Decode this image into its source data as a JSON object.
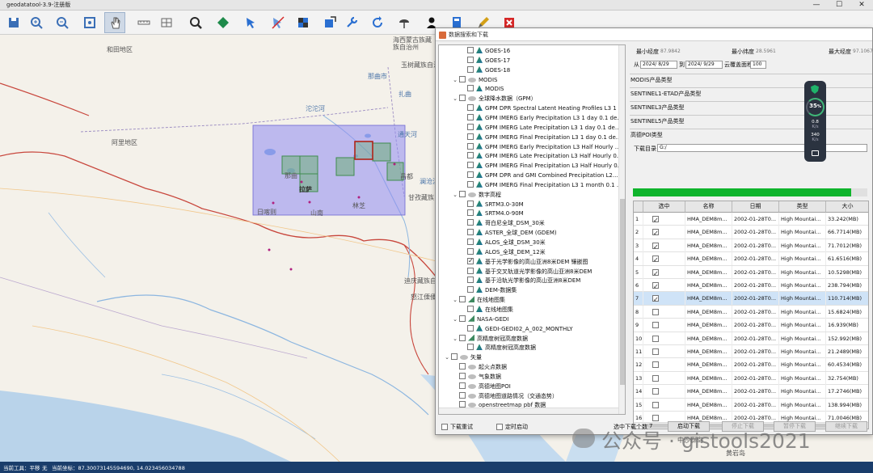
{
  "app": {
    "title": "geodatatool-3.9-注册版"
  },
  "window_controls": [
    "—",
    "☐",
    "✕"
  ],
  "toolbar": {
    "buttons": [
      {
        "name": "save-icon",
        "color": "#3b6fb6"
      },
      {
        "name": "zoom-in-icon",
        "color": "#3b6fb6"
      },
      {
        "name": "zoom-out-icon",
        "color": "#3b6fb6"
      },
      {
        "name": "full-extent-icon",
        "color": "#3b6fb6"
      },
      {
        "name": "pan-icon",
        "color": "#555555",
        "active": true
      },
      {
        "name": "measure-icon",
        "color": "#666666"
      },
      {
        "name": "grid-icon",
        "color": "#666666"
      },
      {
        "name": "identify-icon",
        "color": "#2a2a2a"
      },
      {
        "name": "layer-icon",
        "color": "#1e8a4a"
      },
      {
        "name": "select-icon",
        "color": "#2a6fd1"
      },
      {
        "name": "clear-select-icon",
        "color": "#2a6fd1"
      },
      {
        "name": "checker-icon",
        "color": "#333333"
      },
      {
        "name": "export-icon",
        "color": "#2a6fd1"
      },
      {
        "name": "tools-icon",
        "color": "#2a6fd1"
      },
      {
        "name": "refresh-icon",
        "color": "#2a6fd1"
      },
      {
        "name": "cloud-icon",
        "color": "#444444"
      },
      {
        "name": "user-icon",
        "color": "#111111"
      },
      {
        "name": "book-icon",
        "color": "#2a6fd1"
      },
      {
        "name": "pencil-icon",
        "color": "#d4a017"
      },
      {
        "name": "close-red-icon",
        "color": "#d62828"
      }
    ]
  },
  "map": {
    "labels": [
      {
        "text": "和田地区",
        "style": ""
      },
      {
        "text": "海西蒙古族藏族自治州",
        "style": ""
      },
      {
        "text": "玉树藏族自治州",
        "style": ""
      },
      {
        "text": "那曲市",
        "style": "blue"
      },
      {
        "text": "扎曲",
        "style": "blue"
      },
      {
        "text": "沱沱河",
        "style": "blue"
      },
      {
        "text": "阿里地区",
        "style": ""
      },
      {
        "text": "那曲",
        "style": ""
      },
      {
        "text": "拉萨",
        "style": "bold"
      },
      {
        "text": "日喀则",
        "style": ""
      },
      {
        "text": "山南",
        "style": ""
      },
      {
        "text": "林芝",
        "style": ""
      },
      {
        "text": "昌都",
        "style": ""
      },
      {
        "text": "澜沧江",
        "style": "blue"
      },
      {
        "text": "迪庆藏族自治州",
        "style": ""
      },
      {
        "text": "怒江傈僳族自治州",
        "style": ""
      },
      {
        "text": "通天河",
        "style": "blue"
      },
      {
        "text": "甘孜藏族自治州",
        "style": ""
      },
      {
        "text": "中沙群岛",
        "style": ""
      },
      {
        "text": "黄岩岛",
        "style": ""
      }
    ]
  },
  "dialog": {
    "title": "数据搜索和下载",
    "tree": [
      {
        "level": 2,
        "exp": "",
        "checked": false,
        "icon": "leaf",
        "label": "GOES-16"
      },
      {
        "level": 2,
        "exp": "",
        "checked": false,
        "icon": "leaf",
        "label": "GOES-17"
      },
      {
        "level": 2,
        "exp": "",
        "checked": false,
        "icon": "leaf",
        "label": "GOES-18"
      },
      {
        "level": 1,
        "exp": "⌄",
        "checked": false,
        "icon": "folder",
        "label": "MODIS"
      },
      {
        "level": 2,
        "exp": "",
        "checked": false,
        "icon": "leaf",
        "label": "MODIS"
      },
      {
        "level": 1,
        "exp": "⌄",
        "checked": false,
        "icon": "folder",
        "label": "全球降水数据（GPM）"
      },
      {
        "level": 2,
        "exp": "",
        "checked": false,
        "icon": "leaf",
        "label": "GPM DPR Spectral Latent Heating Profiles L3 1 ..."
      },
      {
        "level": 2,
        "exp": "",
        "checked": false,
        "icon": "leaf",
        "label": "GPM IMERG Early Precipitation L3 1 day 0.1 de..."
      },
      {
        "level": 2,
        "exp": "",
        "checked": false,
        "icon": "leaf",
        "label": "GPM IMERG Late Precipitation L3 1 day 0.1 de..."
      },
      {
        "level": 2,
        "exp": "",
        "checked": false,
        "icon": "leaf",
        "label": "GPM IMERG Final Precipitation L3 1 day 0.1 de..."
      },
      {
        "level": 2,
        "exp": "",
        "checked": false,
        "icon": "leaf",
        "label": "GPM IMERG Early Precipitation L3 Half Hourly ..."
      },
      {
        "level": 2,
        "exp": "",
        "checked": false,
        "icon": "leaf",
        "label": "GPM IMERG Late Precipitation L3 Half Hourly 0..."
      },
      {
        "level": 2,
        "exp": "",
        "checked": false,
        "icon": "leaf",
        "label": "GPM IMERG Final Precipitation L3 Half Hourly 0..."
      },
      {
        "level": 2,
        "exp": "",
        "checked": false,
        "icon": "leaf",
        "label": "GPM DPR and GMI Combined Precipitation L2..."
      },
      {
        "level": 2,
        "exp": "",
        "checked": false,
        "icon": "leaf",
        "label": "GPM IMERG Final Precipitation L3 1 month 0.1 ..."
      },
      {
        "level": 1,
        "exp": "⌄",
        "checked": false,
        "icon": "folder",
        "label": "数字高程"
      },
      {
        "level": 2,
        "exp": "",
        "checked": false,
        "icon": "leaf",
        "label": "SRTM3.0-30M"
      },
      {
        "level": 2,
        "exp": "",
        "checked": false,
        "icon": "leaf",
        "label": "SRTM4.0-90M"
      },
      {
        "level": 2,
        "exp": "",
        "checked": false,
        "icon": "leaf",
        "label": "哥白尼全球_DSM_30米"
      },
      {
        "level": 2,
        "exp": "",
        "checked": false,
        "icon": "leaf",
        "label": "ASTER_全球_DEM (GDEM)"
      },
      {
        "level": 2,
        "exp": "",
        "checked": false,
        "icon": "leaf",
        "label": "ALOS_全球_DSM_30米"
      },
      {
        "level": 2,
        "exp": "",
        "checked": false,
        "icon": "leaf",
        "label": "ALOS_全球_DEM_12米"
      },
      {
        "level": 2,
        "exp": "",
        "checked": true,
        "icon": "leaf",
        "label": "基于光学影像的高山亚洲8米DEM 镶嵌图"
      },
      {
        "level": 2,
        "exp": "",
        "checked": false,
        "icon": "leaf",
        "label": "基于交叉轨道光学影像的高山亚洲8米DEM"
      },
      {
        "level": 2,
        "exp": "",
        "checked": false,
        "icon": "leaf",
        "label": "基于沿轨光学影像的高山亚洲8米DEM"
      },
      {
        "level": 2,
        "exp": "",
        "checked": false,
        "icon": "leaf",
        "label": "DEM-数据集"
      },
      {
        "level": 1,
        "exp": "⌄",
        "checked": false,
        "icon": "ruler",
        "label": "在线地图集"
      },
      {
        "level": 2,
        "exp": "",
        "checked": false,
        "icon": "leaf",
        "label": "在线地图集"
      },
      {
        "level": 1,
        "exp": "⌄",
        "checked": false,
        "icon": "ruler",
        "label": "NASA-GEDI"
      },
      {
        "level": 2,
        "exp": "",
        "checked": false,
        "icon": "leaf",
        "label": "GEDI-GEDI02_A_002_MONTHLY"
      },
      {
        "level": 1,
        "exp": "⌄",
        "checked": false,
        "icon": "ruler",
        "label": "高精度树冠高度数据"
      },
      {
        "level": 2,
        "exp": "",
        "checked": false,
        "icon": "leaf",
        "label": "高精度树冠高度数据"
      },
      {
        "level": 0,
        "exp": "⌄",
        "checked": false,
        "icon": "folder",
        "label": "矢量"
      },
      {
        "level": 1,
        "exp": "",
        "checked": false,
        "icon": "folder",
        "label": "起火点数据"
      },
      {
        "level": 1,
        "exp": "",
        "checked": false,
        "icon": "folder",
        "label": "气象数据"
      },
      {
        "level": 1,
        "exp": "",
        "checked": false,
        "icon": "folder",
        "label": "高德地图POI"
      },
      {
        "level": 1,
        "exp": "",
        "checked": false,
        "icon": "folder",
        "label": "高德地图道路情况（交通态势）"
      },
      {
        "level": 1,
        "exp": "",
        "checked": false,
        "icon": "folder",
        "label": "openstreetmap pbf 数据"
      }
    ],
    "bounds": {
      "min_lon_label": "最小经度",
      "min_lon_value": "87.9842",
      "min_lat_label": "最小纬度",
      "min_lat_value": "28.5961",
      "max_lon_label": "最大经度",
      "max_lon_value": "97.1067"
    },
    "date_filter": {
      "from_label": "从",
      "from_value": "2024/ 8/29",
      "to_label": "到",
      "to_value": "2024/ 9/29",
      "cloud_label": "云覆盖面积",
      "cloud_value": "100"
    },
    "sections": [
      "MODIS产品类型",
      "SENTINEL1-ETAD产品类型",
      "SENTINEL3产品类型",
      "SENTINEL5产品类型",
      "高德POI类型"
    ],
    "download_dir_label": "下载目录",
    "download_dir_value": "G:/",
    "progress_fraction": 0.93,
    "table": {
      "headers": [
        "",
        "选中",
        "名称",
        "日期",
        "类型",
        "大小"
      ],
      "rows": [
        {
          "idx": "1",
          "checked": true,
          "name": "HMA_DEM8m...",
          "date": "2002-01-28T0...",
          "type": "High Mountai...",
          "size": "33.242(MB)"
        },
        {
          "idx": "2",
          "checked": true,
          "name": "HMA_DEM8m...",
          "date": "2002-01-28T0...",
          "type": "High Mountai...",
          "size": "66.7714(MB)"
        },
        {
          "idx": "3",
          "checked": true,
          "name": "HMA_DEM8m...",
          "date": "2002-01-28T0...",
          "type": "High Mountai...",
          "size": "71.7012(MB)"
        },
        {
          "idx": "4",
          "checked": true,
          "name": "HMA_DEM8m...",
          "date": "2002-01-28T0...",
          "type": "High Mountai...",
          "size": "61.6516(MB)"
        },
        {
          "idx": "5",
          "checked": true,
          "name": "HMA_DEM8m...",
          "date": "2002-01-28T0...",
          "type": "High Mountai...",
          "size": "10.5298(MB)"
        },
        {
          "idx": "6",
          "checked": true,
          "name": "HMA_DEM8m...",
          "date": "2002-01-28T0...",
          "type": "High Mountai...",
          "size": "238.794(MB)"
        },
        {
          "idx": "7",
          "checked": true,
          "name": "HMA_DEM8m...",
          "date": "2002-01-28T0...",
          "type": "High Mountai...",
          "size": "110.714(MB)",
          "selected": true
        },
        {
          "idx": "8",
          "checked": false,
          "name": "HMA_DEM8m...",
          "date": "2002-01-28T0...",
          "type": "High Mountai...",
          "size": "15.6824(MB)"
        },
        {
          "idx": "9",
          "checked": false,
          "name": "HMA_DEM8m...",
          "date": "2002-01-28T0...",
          "type": "High Mountai...",
          "size": "16.939(MB)"
        },
        {
          "idx": "10",
          "checked": false,
          "name": "HMA_DEM8m...",
          "date": "2002-01-28T0...",
          "type": "High Mountai...",
          "size": "152.992(MB)"
        },
        {
          "idx": "11",
          "checked": false,
          "name": "HMA_DEM8m...",
          "date": "2002-01-28T0...",
          "type": "High Mountai...",
          "size": "21.2489(MB)"
        },
        {
          "idx": "12",
          "checked": false,
          "name": "HMA_DEM8m...",
          "date": "2002-01-28T0...",
          "type": "High Mountai...",
          "size": "60.4534(MB)"
        },
        {
          "idx": "13",
          "checked": false,
          "name": "HMA_DEM8m...",
          "date": "2002-01-28T0...",
          "type": "High Mountai...",
          "size": "32.754(MB)"
        },
        {
          "idx": "14",
          "checked": false,
          "name": "HMA_DEM8m...",
          "date": "2002-01-28T0...",
          "type": "High Mountai...",
          "size": "17.2746(MB)"
        },
        {
          "idx": "15",
          "checked": false,
          "name": "HMA_DEM8m...",
          "date": "2002-01-28T0...",
          "type": "High Mountai...",
          "size": "138.994(MB)"
        },
        {
          "idx": "16",
          "checked": false,
          "name": "HMA_DEM8m...",
          "date": "2002-01-28T0...",
          "type": "High Mountai...",
          "size": "71.0046(MB)"
        }
      ]
    },
    "footer": {
      "redownload_label": "下载重试",
      "timer_label": "定时启动",
      "selected_count_label": "选中下载个数",
      "selected_count_value": "7",
      "start_btn": "启动下载",
      "stop_btn": "停止下载",
      "pause_btn": "暂停下载",
      "resume_btn": "继续下载"
    }
  },
  "net_widget": {
    "percent": "35",
    "percent_unit": "%",
    "up": "0.8",
    "up_unit": "K/s",
    "down": "340",
    "down_unit": "K/s"
  },
  "statusbar": {
    "tool_label": "当前工具：平移",
    "sep": "无",
    "coords": "当前坐标：87.30073145594690, 14.023456034788"
  },
  "watermark": {
    "text": "公众号 · gistools2021"
  }
}
